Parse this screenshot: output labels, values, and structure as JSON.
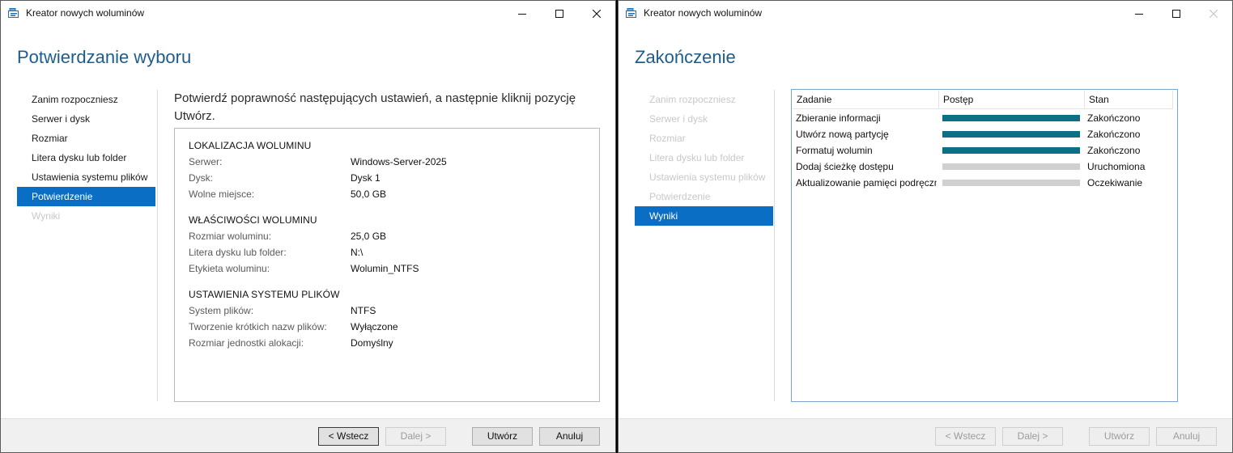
{
  "left_window": {
    "title": "Kreator nowych woluminów",
    "page_title": "Potwierdzanie wyboru",
    "nav": [
      {
        "label": "Zanim rozpoczniesz",
        "state": "normal"
      },
      {
        "label": "Serwer i dysk",
        "state": "normal"
      },
      {
        "label": "Rozmiar",
        "state": "normal"
      },
      {
        "label": "Litera dysku lub folder",
        "state": "normal"
      },
      {
        "label": "Ustawienia systemu plików",
        "state": "normal"
      },
      {
        "label": "Potwierdzenie",
        "state": "active"
      },
      {
        "label": "Wyniki",
        "state": "disabled"
      }
    ],
    "instructions": "Potwierdź poprawność następujących ustawień, a następnie kliknij pozycję Utwórz.",
    "sections": [
      {
        "heading": "LOKALIZACJA WOLUMINU",
        "rows": [
          {
            "label": "Serwer:",
            "value": "Windows-Server-2025"
          },
          {
            "label": "Dysk:",
            "value": "Dysk 1"
          },
          {
            "label": "Wolne miejsce:",
            "value": "50,0 GB"
          }
        ]
      },
      {
        "heading": "WŁAŚCIWOŚCI WOLUMINU",
        "rows": [
          {
            "label": "Rozmiar woluminu:",
            "value": "25,0 GB"
          },
          {
            "label": "Litera dysku lub folder:",
            "value": "N:\\"
          },
          {
            "label": "Etykieta woluminu:",
            "value": "Wolumin_NTFS"
          }
        ]
      },
      {
        "heading": "USTAWIENIA SYSTEMU PLIKÓW",
        "rows": [
          {
            "label": "System plików:",
            "value": "NTFS"
          },
          {
            "label": "Tworzenie krótkich nazw plików:",
            "value": "Wyłączone"
          },
          {
            "label": "Rozmiar jednostki alokacji:",
            "value": "Domyślny"
          }
        ]
      }
    ],
    "buttons": {
      "back": "< Wstecz",
      "next": "Dalej >",
      "create": "Utwórz",
      "cancel": "Anuluj"
    }
  },
  "right_window": {
    "title": "Kreator nowych woluminów",
    "page_title": "Zakończenie",
    "nav": [
      {
        "label": "Zanim rozpoczniesz",
        "state": "disabled"
      },
      {
        "label": "Serwer i dysk",
        "state": "disabled"
      },
      {
        "label": "Rozmiar",
        "state": "disabled"
      },
      {
        "label": "Litera dysku lub folder",
        "state": "disabled"
      },
      {
        "label": "Ustawienia systemu plików",
        "state": "disabled"
      },
      {
        "label": "Potwierdzenie",
        "state": "disabled"
      },
      {
        "label": "Wyniki",
        "state": "active"
      }
    ],
    "columns": {
      "task": "Zadanie",
      "progress": "Postęp",
      "status": "Stan"
    },
    "tasks": [
      {
        "task": "Zbieranie informacji",
        "progress": 1.0,
        "status": "Zakończono"
      },
      {
        "task": "Utwórz nową partycję",
        "progress": 1.0,
        "status": "Zakończono"
      },
      {
        "task": "Formatuj wolumin",
        "progress": 1.0,
        "status": "Zakończono"
      },
      {
        "task": "Dodaj ścieżkę dostępu",
        "progress": 0.0,
        "status": "Uruchomiona"
      },
      {
        "task": "Aktualizowanie pamięci podręcznej",
        "progress": 0.0,
        "status": "Oczekiwanie"
      }
    ],
    "buttons": {
      "back": "< Wstecz",
      "next": "Dalej >",
      "create": "Utwórz",
      "cancel": "Anuluj"
    }
  },
  "colors": {
    "accent": "#0a6ec4",
    "title": "#1d5d8c",
    "progress_fill": "#0d6f85"
  }
}
